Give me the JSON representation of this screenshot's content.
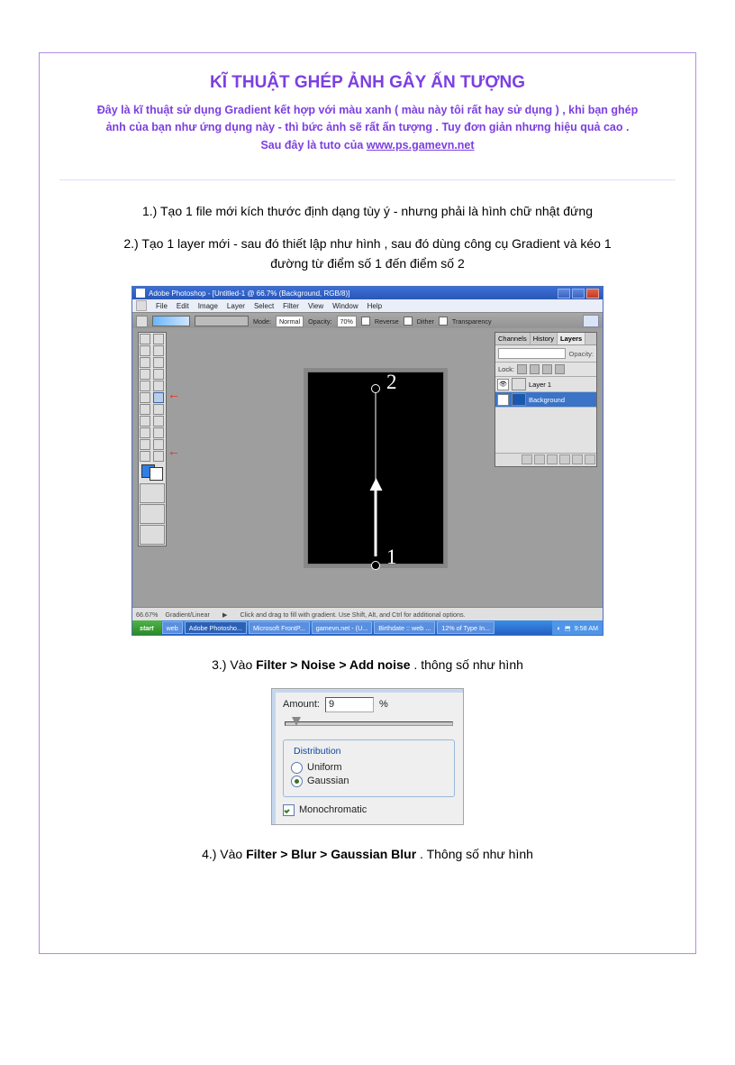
{
  "title": "KĨ THUẬT GHÉP ẢNH GÂY ẤN TƯỢNG",
  "intro_lines": {
    "l1": "Đây là kĩ thuật sử dụng Gradient kết hợp với màu xanh ( màu này tôi rất hay sử dụng ) , khi bạn ghép",
    "l2": "ảnh của bạn như ứng dụng này - thì bức ảnh sẽ rất ấn tượng . Tuy đơn giản nhưng hiệu quả cao .",
    "l3_pre": "Sau đây là tuto của ",
    "l3_link": "www.ps.gamevn.net"
  },
  "steps": {
    "s1": "1.) Tạo 1 file mới kích thước định dạng tùy ý - nhưng phải là hình chữ nhật đứng",
    "s2a": "2.) Tạo 1 layer mới - sau đó thiết lập như hình  , sau đó dùng công cụ Gradient và kéo 1",
    "s2b": "đường từ điểm số 1 đến điểm số 2",
    "s3_pre": "3.) Vào ",
    "s3_bold": "Filter > Noise > Add noise",
    "s3_post": " . thông số như hình",
    "s4_pre": "4.) Vào ",
    "s4_bold": "Filter > Blur > Gaussian Blur",
    "s4_post": "  . Thông số như hình"
  },
  "ps": {
    "titlebar": "Adobe Photoshop - [Untitled-1 @ 66.7% (Background, RGB/8)]",
    "menus": [
      "File",
      "Edit",
      "Image",
      "Layer",
      "Select",
      "Filter",
      "View",
      "Window",
      "Help"
    ],
    "options": {
      "mode_label": "Mode:",
      "mode_value": "Normal",
      "opacity_label": "Opacity:",
      "opacity_value": "70%",
      "reverse": "Reverse",
      "dither": "Dither",
      "transparency": "Transparency"
    },
    "layers": {
      "tabs": [
        "Channels",
        "History",
        "Layers"
      ],
      "opacity": "Opacity:",
      "lock": "Lock:",
      "row1": "Layer 1",
      "row2": "Background"
    },
    "status": {
      "zoom": "66.67%",
      "mode": "Gradient/Linear",
      "hint": "Click and drag to fill with gradient. Use Shift, Alt, and Ctrl for additional options."
    },
    "taskbar": {
      "start": "start",
      "items": [
        "web",
        "Adobe Photosho...",
        "Microsoft FrontP...",
        "gamevn.net - (U...",
        "Birthdate :: web ...",
        "12% of Type In..."
      ],
      "time": "9:58 AM"
    },
    "points": {
      "p1": "1",
      "p2": "2"
    }
  },
  "noise": {
    "amount_label": "Amount:",
    "amount_value": "9",
    "pct": "%",
    "dist_legend": "Distribution",
    "uniform": "Uniform",
    "gaussian": "Gaussian",
    "mono": "Monochromatic"
  }
}
